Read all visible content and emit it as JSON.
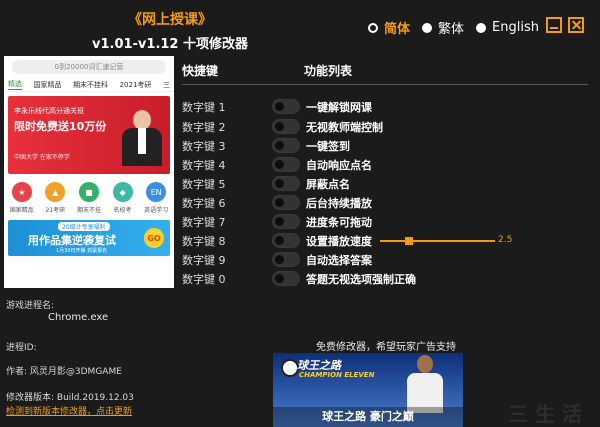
{
  "header": {
    "game_title": "《网上授课》",
    "version_title": "v1.01-v1.12 十项修改器"
  },
  "languages": [
    {
      "label": "简体",
      "selected": true
    },
    {
      "label": "繁体",
      "selected": false
    },
    {
      "label": "English",
      "selected": false
    }
  ],
  "window": {
    "minimize": "minimize",
    "close": "close"
  },
  "preview": {
    "search_placeholder": "0到20000词汇速记营",
    "tabs": [
      "精选",
      "国家精品",
      "期末不挂科",
      "2021考研",
      "三"
    ],
    "banner_small": "李永乐线代高分通关班",
    "banner_big_1": "限时免费送10万份",
    "banner_sub": "中国大学 在家不停学",
    "icons": [
      {
        "label": "国家精品",
        "color": "#e8434b"
      },
      {
        "label": "21考研",
        "color": "#f0a12c"
      },
      {
        "label": "期末不挂",
        "color": "#34b06a"
      },
      {
        "label": "名校考",
        "color": "#3fb9a7"
      },
      {
        "label": "英语学习",
        "color": "#3a8ee6"
      }
    ],
    "ad_top": "20级计专享福利",
    "ad_main": "用作品集逆袭复试",
    "ad_sub": "1月30日开播 抓紧报名",
    "ad_go": "GO"
  },
  "info": {
    "process_label": "游戏进程名:",
    "process_name": "Chrome.exe",
    "pid_label": "进程ID:",
    "author": "作者: 风灵月影@3DMGAME",
    "build": "修改器版本: Build.2019.12.03",
    "update_link": "检测到新版本修改器，点击更新"
  },
  "table": {
    "col_hotkey": "快捷键",
    "col_function": "功能列表",
    "rows": [
      {
        "key": "数字键 1",
        "name": "一键解锁网课"
      },
      {
        "key": "数字键 2",
        "name": "无视教师端控制"
      },
      {
        "key": "数字键 3",
        "name": "一键签到"
      },
      {
        "key": "数字键 4",
        "name": "自动响应点名"
      },
      {
        "key": "数字键 5",
        "name": "屏蔽点名"
      },
      {
        "key": "数字键 6",
        "name": "后台持续播放"
      },
      {
        "key": "数字键 7",
        "name": "进度条可拖动"
      },
      {
        "key": "数字键 8",
        "name": "设置播放速度"
      },
      {
        "key": "数字键 9",
        "name": "自动选择答案"
      },
      {
        "key": "数字键 0",
        "name": "答题无视选项强制正确"
      }
    ],
    "speed_value": "2.5",
    "speed_fraction": 0.25
  },
  "footer": {
    "ad_note": "免费修改器，希望玩家广告支持",
    "ad_name": "球王之路",
    "ad_eng": "CHAMPION ELEVEN",
    "ad_slogan": "球王之路 豪门之巅",
    "watermark": "三 生 活"
  },
  "colors": {
    "accent": "#f39c12",
    "background": "#1b1b1b"
  }
}
